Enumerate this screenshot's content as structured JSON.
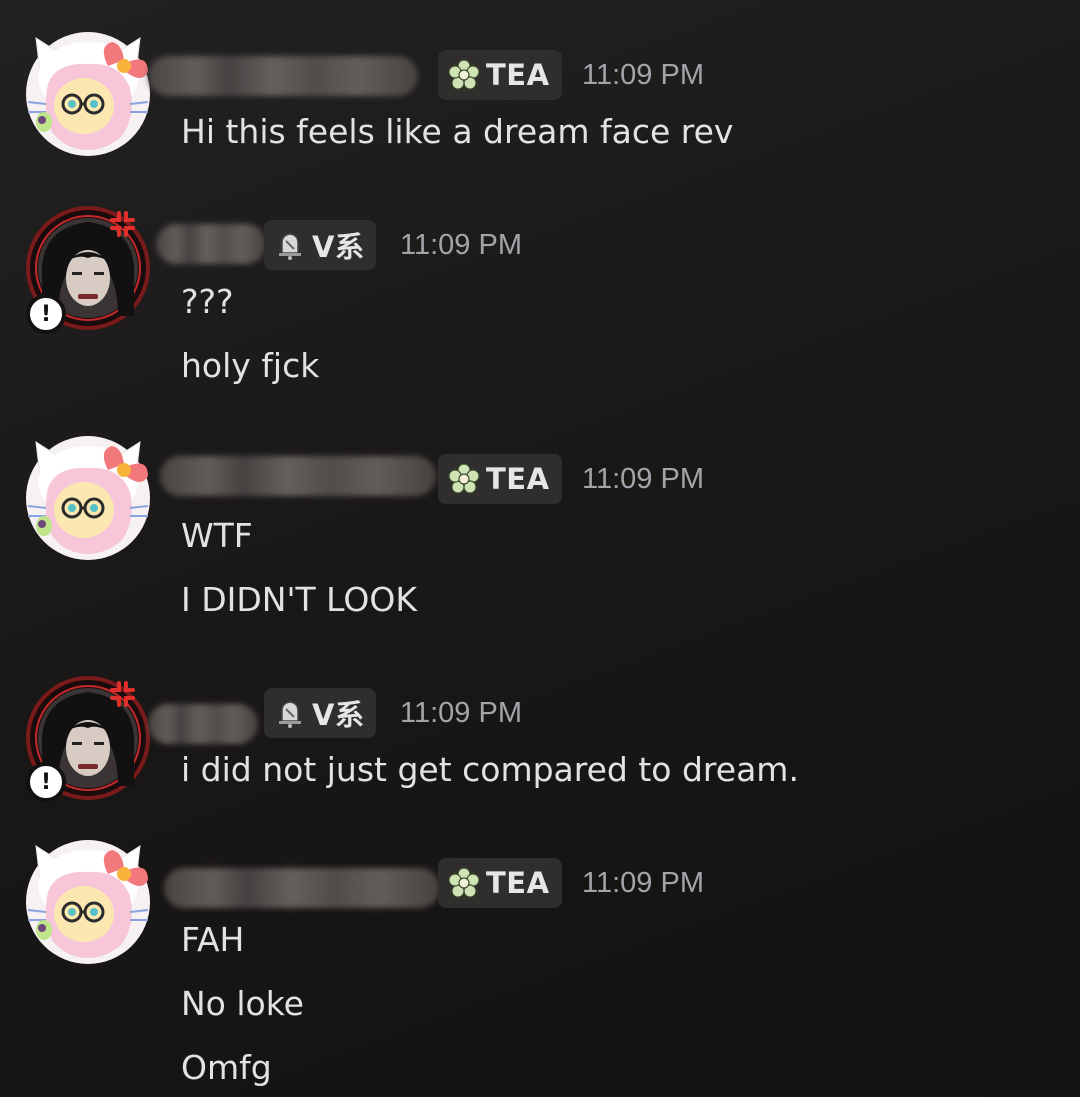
{
  "colors": {
    "background": "#1c1a19",
    "text": "#e2e2e5",
    "timestamp": "#a3a4aa",
    "tag_bg": "#2f2e2d"
  },
  "messages": [
    {
      "author_avatar": "pink-pony-hello-kitty-avatar",
      "tag": {
        "icon": "flower-icon",
        "label": "TEA"
      },
      "timestamp": "11:09 PM",
      "lines": [
        "Hi this feels like a dream face rev"
      ]
    },
    {
      "author_avatar": "dark-haired-person-avatar",
      "tag": {
        "icon": "bell-icon",
        "label": "V系"
      },
      "timestamp": "11:09 PM",
      "lines": [
        "???",
        "holy fjck"
      ]
    },
    {
      "author_avatar": "pink-pony-hello-kitty-avatar",
      "tag": {
        "icon": "flower-icon",
        "label": "TEA"
      },
      "timestamp": "11:09 PM",
      "lines": [
        "WTF",
        "I DIDN'T LOOK"
      ]
    },
    {
      "author_avatar": "dark-haired-person-avatar",
      "tag": {
        "icon": "bell-icon",
        "label": "V系"
      },
      "timestamp": "11:09 PM",
      "lines": [
        "i did not just get compared to dream."
      ]
    },
    {
      "author_avatar": "pink-pony-hello-kitty-avatar",
      "tag": {
        "icon": "flower-icon",
        "label": "TEA"
      },
      "timestamp": "11:09 PM",
      "lines": [
        "FAH",
        "No loke",
        "Omfg"
      ]
    }
  ]
}
